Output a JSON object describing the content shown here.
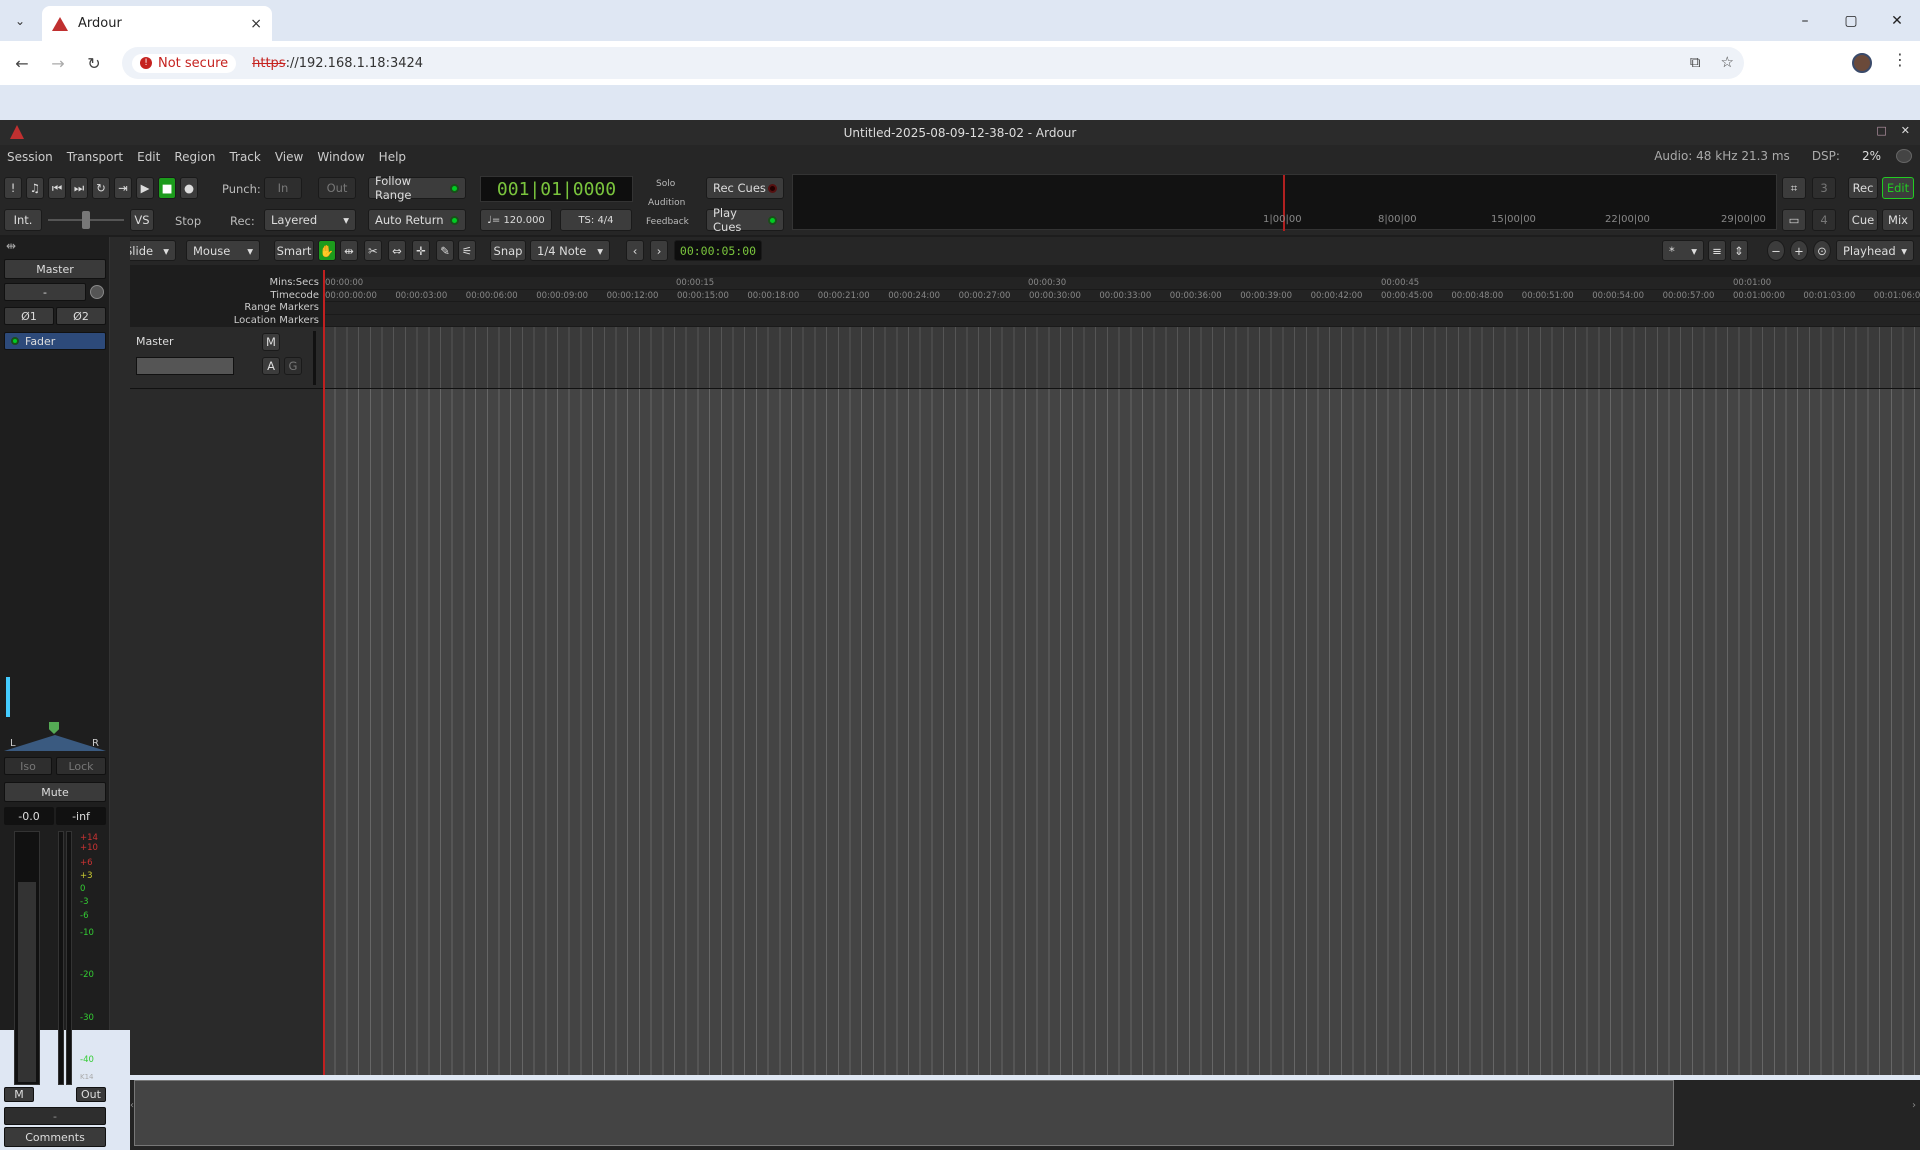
{
  "browser": {
    "tab_title": "Ardour",
    "tab_close": "×",
    "not_secure": "Not secure",
    "url_scheme": "https",
    "url_rest": "://192.168.1.18:3424",
    "win_min": "–",
    "win_max": "▢",
    "win_close": "✕"
  },
  "app": {
    "title": "Untitled-2025-08-09-12-38-02 - Ardour",
    "menu": [
      "Session",
      "Transport",
      "Edit",
      "Region",
      "Track",
      "View",
      "Window",
      "Help"
    ],
    "status": {
      "audio": "Audio: 48 kHz 21.3 ms",
      "dsp_label": "DSP:",
      "dsp": "2%"
    },
    "toolbar": {
      "punch": "Punch:",
      "in": "In",
      "out": "Out",
      "follow_range": "Follow Range",
      "auto_return": "Auto Return",
      "rec": "Rec:",
      "rec_mode": "Layered",
      "int": "Int.",
      "vs": "VS",
      "stop": "Stop",
      "clock": "001|01|0000",
      "tempo": "♩= 120.000",
      "ts": "TS: 4/4",
      "solo": "Solo",
      "audition": "Audition",
      "feedback": "Feedback",
      "rec_cues": "Rec Cues",
      "play_cues": "Play Cues",
      "btn_rec": "Rec",
      "btn_edit": "Edit",
      "btn_cue": "Cue",
      "btn_mix": "Mix",
      "num3": "3",
      "num4": "4",
      "mini_ticks": [
        "1|00|00",
        "8|00|00",
        "15|00|00",
        "22|00|00",
        "29|00|00"
      ]
    },
    "editbar": {
      "slide": "Slide",
      "mouse": "Mouse",
      "smart": "Smart",
      "snap": "Snap",
      "grid": "1/4 Note",
      "nudge": "00:00:05:00",
      "star": "*",
      "playhead": "Playhead"
    },
    "rulers": {
      "labels": [
        "Mins:Secs",
        "Timecode",
        "Range Markers",
        "Location Markers"
      ],
      "mins": [
        "00:00:00",
        "00:00:15",
        "00:00:30",
        "00:00:45",
        "00:01:00"
      ],
      "tc": [
        "00:00:00:00",
        "00:00:03:00",
        "00:00:06:00",
        "00:00:09:00",
        "00:00:12:00",
        "00:00:15:00",
        "00:00:18:00",
        "00:00:21:00",
        "00:00:24:00",
        "00:00:27:00",
        "00:00:30:00",
        "00:00:33:00",
        "00:00:36:00",
        "00:00:39:00",
        "00:00:42:00",
        "00:00:45:00",
        "00:00:48:00",
        "00:00:51:00",
        "00:00:54:00",
        "00:00:57:00",
        "00:01:00:00",
        "00:01:03:00",
        "00:01:06:00"
      ]
    },
    "track": {
      "name": "Master",
      "m": "M",
      "a": "A",
      "g": "G"
    },
    "strip": {
      "name": "Master",
      "dash": "-",
      "phase1": "Ø1",
      "phase2": "Ø2",
      "fader": "Fader",
      "L": "L",
      "R": "R",
      "iso": "Iso",
      "lock": "Lock",
      "mute": "Mute",
      "gain": "-0.0",
      "peak": "-inf",
      "m": "M",
      "out": "Out",
      "dash2": "-",
      "comments": "Comments",
      "k14": "K14",
      "scale": [
        "+14",
        "+10",
        "+6",
        "+3",
        "0",
        "-3",
        "-6",
        "-10",
        "-20",
        "-30",
        "-40"
      ]
    }
  }
}
